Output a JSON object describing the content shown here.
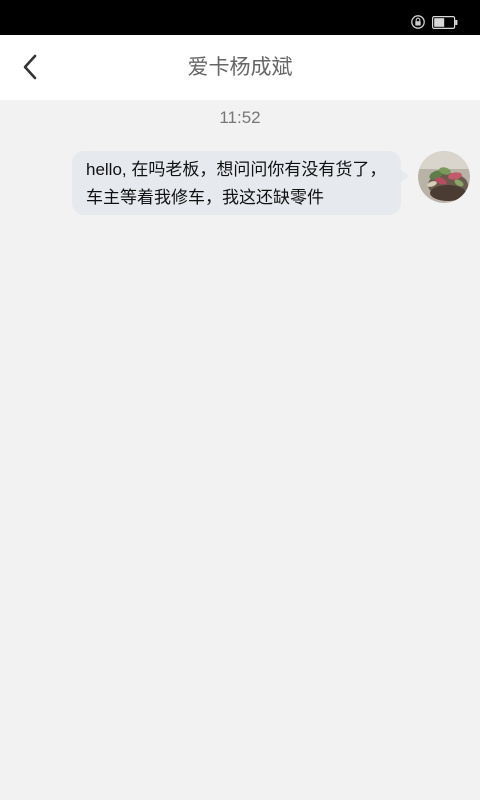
{
  "status_bar": {
    "icons": [
      "lock-icon",
      "battery-icon"
    ],
    "background": "#000000"
  },
  "header": {
    "back_icon": "chevron-left-icon",
    "title": "爱卡杨成斌"
  },
  "chat": {
    "timestamp": "11:52",
    "messages": [
      {
        "sender": "self",
        "text": "hello, 在吗老板，想问问你有没有货了，车主等着我修车，我这还缺零件",
        "avatar_icon": "user-avatar-plant-photo"
      }
    ]
  },
  "colors": {
    "background": "#f2f2f2",
    "bubble": "#e6e9ee",
    "title": "#666666"
  }
}
